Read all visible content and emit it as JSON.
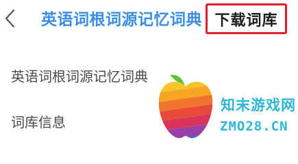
{
  "header": {
    "back_icon": "chevron-left-icon",
    "title": "英语词根词源记忆词典",
    "download_button": "下载词库",
    "accent_color": "#3a8ee6",
    "highlight_border_color": "#e11d2b"
  },
  "list": {
    "items": [
      {
        "label": "英语词根词源记忆词典"
      },
      {
        "label": "词库信息"
      }
    ]
  },
  "watermark": {
    "logo_icon": "apple-logo-icon",
    "text_cn": "知末游戏网",
    "text_url": "ZMO28.CN",
    "color": "#2fb5d8"
  }
}
